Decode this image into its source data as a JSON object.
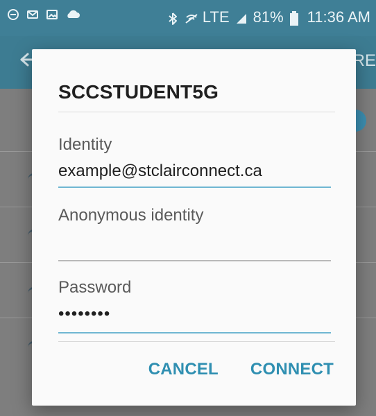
{
  "status_bar": {
    "battery_percent": "81%",
    "time": "11:36 AM",
    "lte": "LTE"
  },
  "app_bar": {
    "right_text": "RE"
  },
  "dialog": {
    "title": "SCCSTUDENT5G",
    "fields": {
      "identity": {
        "label": "Identity",
        "value": "example@stclairconnect.ca"
      },
      "anonymous_identity": {
        "label": "Anonymous identity",
        "value": ""
      },
      "password": {
        "label": "Password",
        "value": "••••••••"
      }
    },
    "actions": {
      "cancel": "CANCEL",
      "connect": "CONNECT"
    }
  },
  "colors": {
    "accent": "#2f8fb1",
    "status_bar": "#3f7f96",
    "app_bar": "#3d7c92",
    "field_active_underline": "#6fb6d2"
  }
}
